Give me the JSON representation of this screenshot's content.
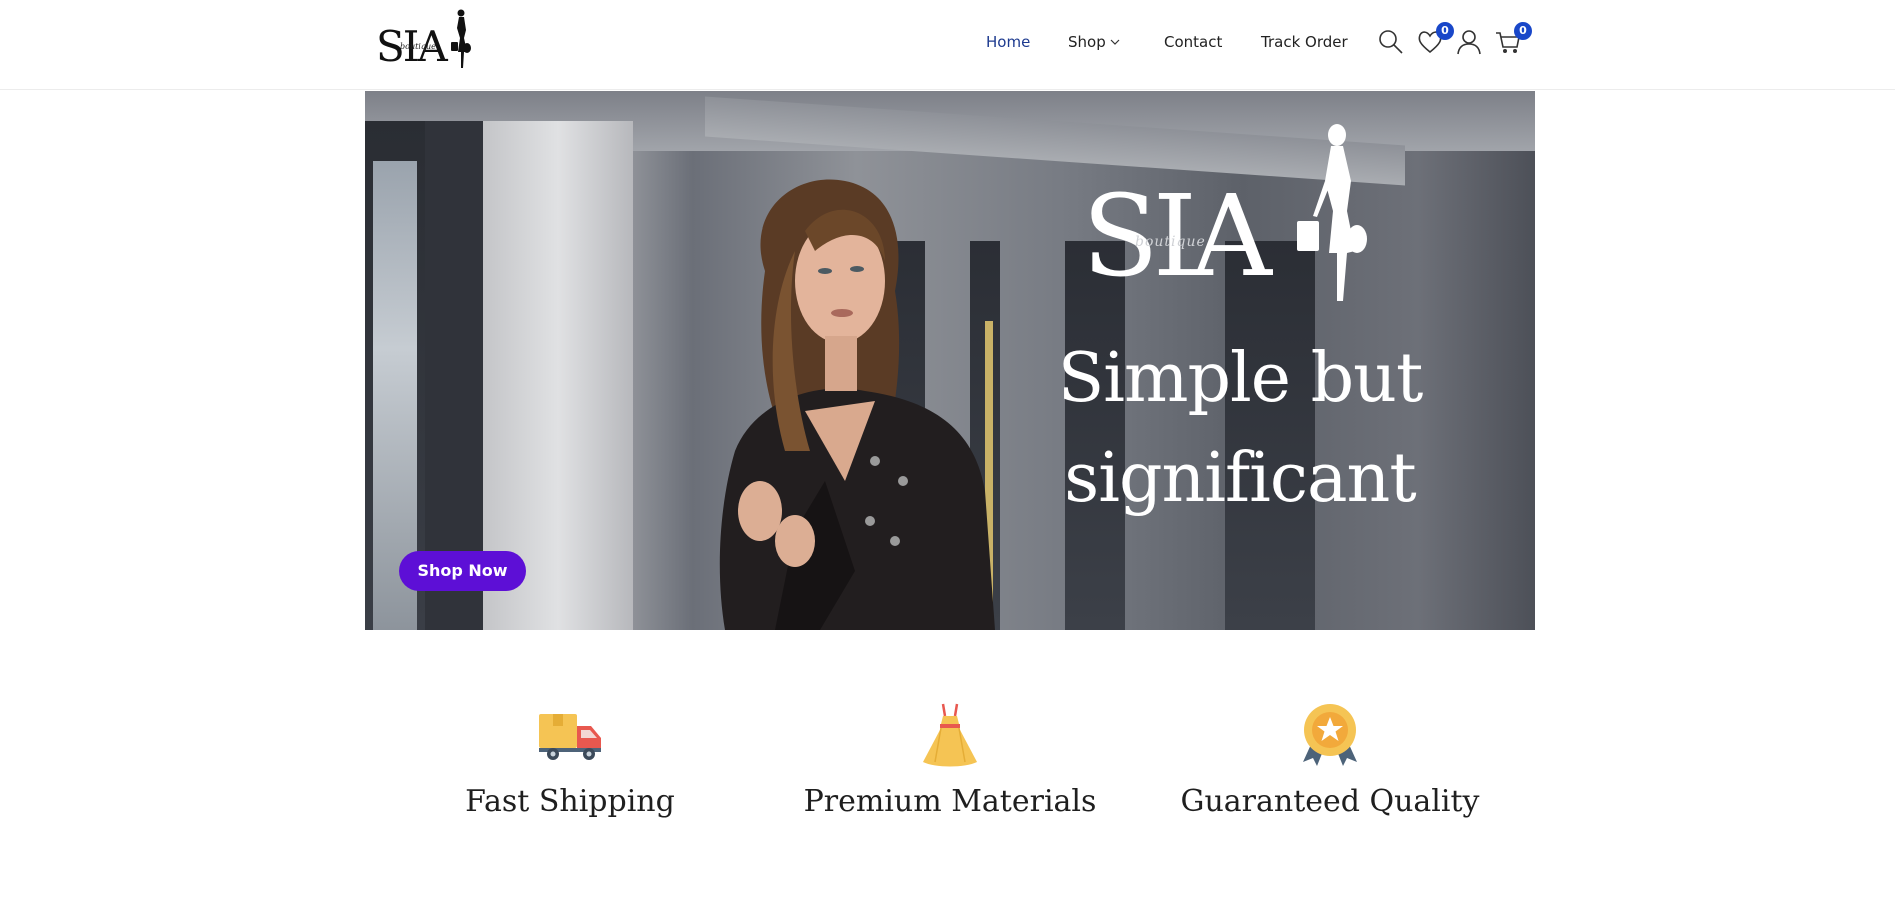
{
  "brand": {
    "logo_text": "SIA",
    "logo_sub": "boutique"
  },
  "nav": {
    "items": [
      {
        "label": "Home",
        "active": true
      },
      {
        "label": "Shop",
        "has_dropdown": true
      },
      {
        "label": "Contact"
      },
      {
        "label": "Track Order"
      }
    ],
    "icons": [
      "search-icon",
      "heart-icon",
      "user-icon",
      "cart-icon"
    ],
    "wishlist_count": "0",
    "cart_count": "0",
    "active_color": "#1d3a8f",
    "badge_color": "#1947c9"
  },
  "hero": {
    "logo_text": "SIA",
    "logo_sub": "boutique",
    "tagline_line1": "Simple but",
    "tagline_line2": "significant",
    "cta_label": "Shop Now",
    "cta_color": "#5d0fd6"
  },
  "features": [
    {
      "icon": "truck-icon",
      "title": "Fast Shipping"
    },
    {
      "icon": "dress-icon",
      "title": "Premium Materials"
    },
    {
      "icon": "medal-icon",
      "title": "Guaranteed Quality"
    }
  ]
}
